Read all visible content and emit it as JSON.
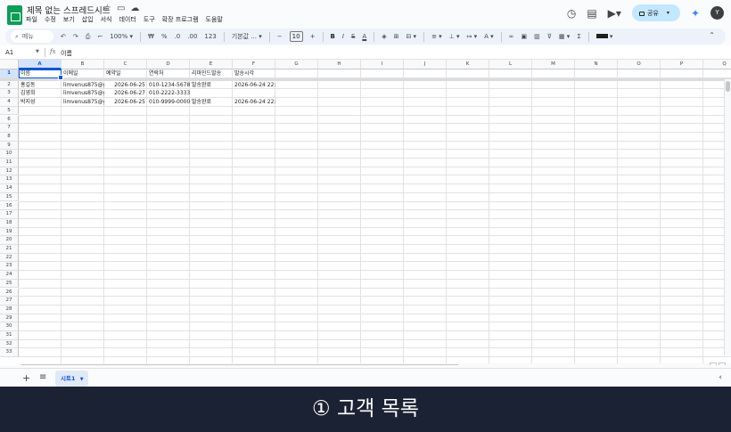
{
  "header": {
    "title": "제목 없는 스프레드시트",
    "menu": [
      "파일",
      "수정",
      "보기",
      "삽입",
      "서식",
      "데이터",
      "도구",
      "확장 프로그램",
      "도움말"
    ],
    "share_label": "공유",
    "avatar_letter": "Y"
  },
  "toolbar": {
    "search_placeholder": "메뉴",
    "zoom": "100%",
    "currency": "₩",
    "percent": "%",
    "dec_decrease": ".0",
    "dec_increase": ".00",
    "format_123": "123",
    "font": "기본값 ...",
    "font_size": "10"
  },
  "formula_bar": {
    "cell_ref": "A1",
    "fx": "fx",
    "content": "이름"
  },
  "grid": {
    "columns": [
      "A",
      "B",
      "C",
      "D",
      "E",
      "F",
      "G",
      "H",
      "I",
      "J",
      "K",
      "L",
      "M",
      "N",
      "O",
      "P",
      "Q"
    ],
    "selected_column": "A",
    "selected_row": 1,
    "row_count": 33,
    "header_row": [
      "이름",
      "이메일",
      "예약일",
      "연락처",
      "리마인드발송",
      "발송시각"
    ],
    "rows": [
      [
        "홍길동",
        "limvenus875@g",
        "2026-06-25",
        "010-1234-5678",
        "발송완료",
        "2026-06-24 22:5"
      ],
      [
        "김영희",
        "limvenus875@g",
        "2026-06-27",
        "010-2222-3333",
        "",
        ""
      ],
      [
        "박지성",
        "limvenus875@g",
        "2026-06-25",
        "010-9999-0000",
        "발송완료",
        "2026-06-24 22:5"
      ]
    ]
  },
  "sheet_tabs": {
    "active_tab": "시트1"
  },
  "caption": "① 고객 목록"
}
